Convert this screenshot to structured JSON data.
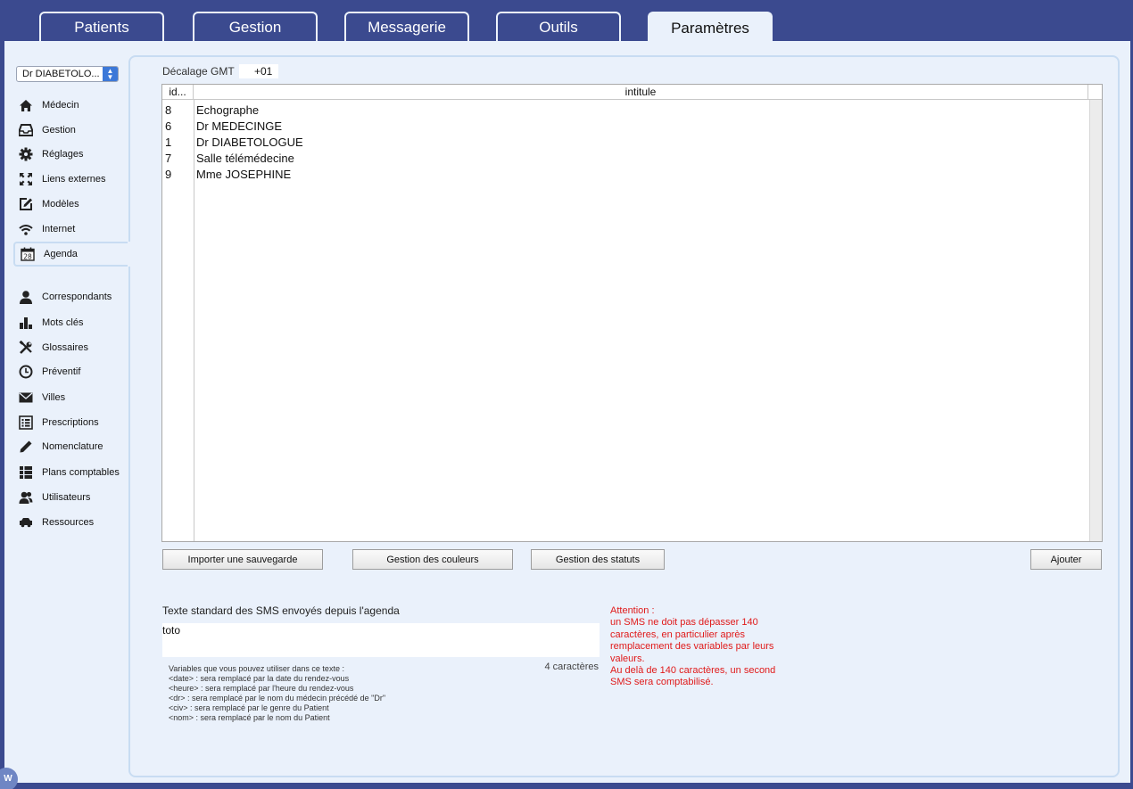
{
  "tabs": [
    {
      "label": "Patients",
      "active": false
    },
    {
      "label": "Gestion",
      "active": false
    },
    {
      "label": "Messagerie",
      "active": false
    },
    {
      "label": "Outils",
      "active": false
    },
    {
      "label": "Paramètres",
      "active": true
    }
  ],
  "doctor_select": {
    "value": "Dr DIABETOLO..."
  },
  "sidebar": {
    "items": [
      {
        "label": "Médecin",
        "icon": "home-icon"
      },
      {
        "label": "Gestion",
        "icon": "inbox-icon"
      },
      {
        "label": "Réglages",
        "icon": "gear-icon"
      },
      {
        "label": "Liens externes",
        "icon": "expand-icon"
      },
      {
        "label": "Modèles",
        "icon": "edit-icon"
      },
      {
        "label": "Internet",
        "icon": "wifi-icon"
      },
      {
        "label": "Agenda",
        "icon": "calendar-icon",
        "active": true,
        "day": "28"
      },
      {
        "label": "Correspondants",
        "icon": "person-icon"
      },
      {
        "label": "Mots clés",
        "icon": "bar-chart-icon"
      },
      {
        "label": "Glossaires",
        "icon": "tools-icon"
      },
      {
        "label": "Préventif",
        "icon": "clock-icon"
      },
      {
        "label": "Villes",
        "icon": "envelope-icon"
      },
      {
        "label": "Prescriptions",
        "icon": "list-icon"
      },
      {
        "label": "Nomenclature",
        "icon": "pencil-icon"
      },
      {
        "label": "Plans comptables",
        "icon": "grid-list-icon"
      },
      {
        "label": "Utilisateurs",
        "icon": "users-icon"
      },
      {
        "label": "Ressources",
        "icon": "car-icon"
      }
    ]
  },
  "gmt": {
    "label": "Décalage GMT",
    "value": "+01"
  },
  "table": {
    "columns": [
      "id...",
      "intitule"
    ],
    "rows": [
      {
        "id": "8",
        "intitule": "Echographe"
      },
      {
        "id": "6",
        "intitule": "Dr MEDECINGE"
      },
      {
        "id": "1",
        "intitule": "Dr DIABETOLOGUE"
      },
      {
        "id": "7",
        "intitule": "Salle télémédecine"
      },
      {
        "id": "9",
        "intitule": "Mme JOSEPHINE"
      }
    ]
  },
  "buttons": {
    "import": "Importer une sauvegarde",
    "colors": "Gestion des couleurs",
    "statuses": "Gestion des statuts",
    "add": "Ajouter"
  },
  "sms": {
    "label": "Texte standard des SMS envoyés depuis l'agenda",
    "value": "toto",
    "count": "4 caractères",
    "variables": [
      "Variables que vous pouvez utiliser dans ce texte :",
      "<date> : sera remplacé par la date du rendez-vous",
      "<heure> : sera remplacé par l'heure du rendez-vous",
      "<dr> : sera remplacé par le nom du médecin précédé de \"Dr\"",
      "<civ> : sera remplacé par le genre du Patient",
      "<nom> : sera remplacé par le nom du Patient"
    ],
    "warning": [
      "Attention :",
      "un SMS ne doit pas dépasser 140",
      "caractères, en particulier après",
      "remplacement des variables par leurs",
      "valeurs.",
      "Au delà de 140 caractères, un second",
      "SMS sera comptabilisé."
    ]
  },
  "badge": "W",
  "colors": {
    "frame": "#3b4a8f",
    "panel": "#eaf1fb",
    "warning": "#e01a1a",
    "select_arrow": "#3c78d8"
  }
}
